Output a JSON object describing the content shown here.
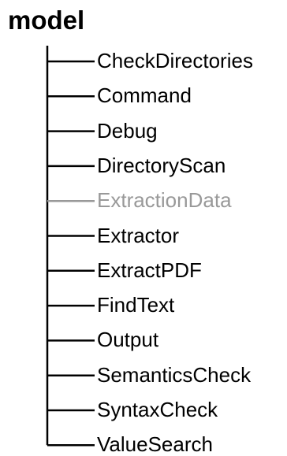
{
  "root": {
    "label": "model"
  },
  "nodes": [
    {
      "label": "CheckDirectories",
      "color": "#000000"
    },
    {
      "label": "Command",
      "color": "#000000"
    },
    {
      "label": "Debug",
      "color": "#000000"
    },
    {
      "label": "DirectoryScan",
      "color": "#000000"
    },
    {
      "label": "ExtractionData",
      "color": "#999999"
    },
    {
      "label": "Extractor",
      "color": "#000000"
    },
    {
      "label": "ExtractPDF",
      "color": "#000000"
    },
    {
      "label": "FindText",
      "color": "#000000"
    },
    {
      "label": "Output",
      "color": "#000000"
    },
    {
      "label": "SemanticsCheck",
      "color": "#000000"
    },
    {
      "label": "SyntaxCheck",
      "color": "#000000"
    },
    {
      "label": "ValueSearch",
      "color": "#000000"
    }
  ]
}
